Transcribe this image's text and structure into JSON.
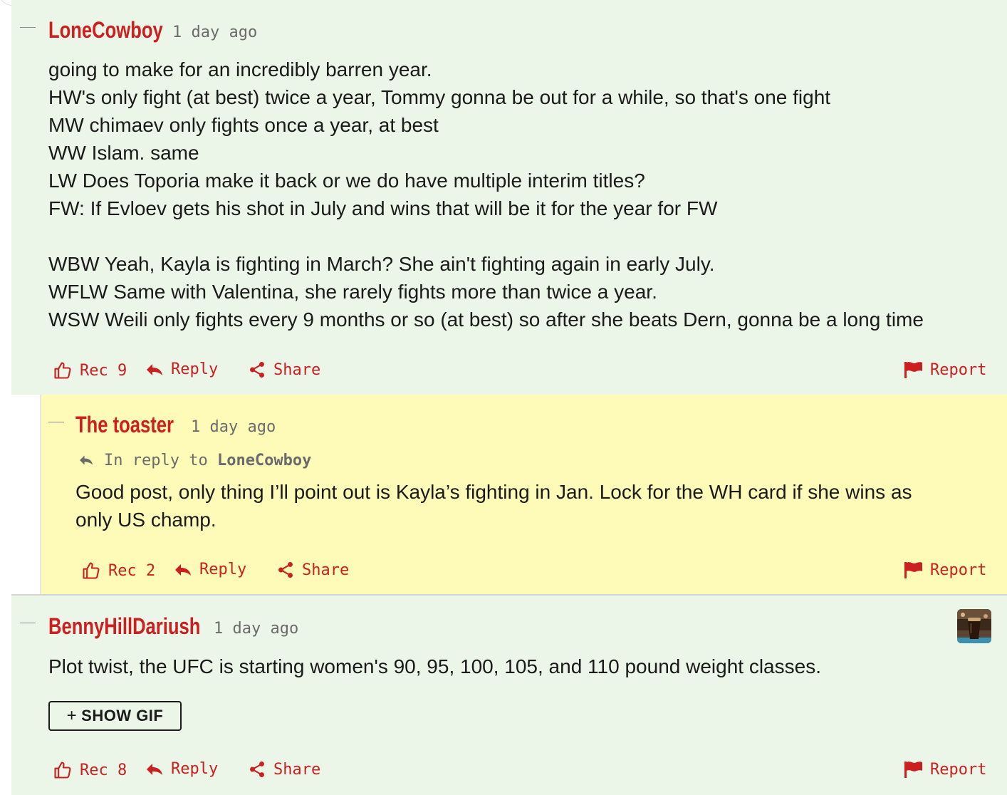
{
  "comments": [
    {
      "author": "LoneCowboy",
      "time": "1 day ago",
      "lines": [
        "going to make for an incredibly barren year.",
        "HW's only fight (at best) twice a year, Tommy gonna be out for a while, so that's one fight",
        "MW chimaev only fights once a year, at best",
        "WW Islam. same",
        "LW Does Toporia make it back or we do have multiple interim titles?",
        "FW: If Evloev gets his shot in July and wins that will be it for the year for FW",
        "",
        "WBW Yeah, Kayla is fighting in March? She ain't fighting again in early July.",
        "WFLW Same with Valentina, she rarely fights more than twice a year.",
        "WSW Weili only fights every 9 months or so (at best) so after she beats Dern, gonna be a long time"
      ],
      "rec": "Rec 9",
      "reply": "Reply",
      "share": "Share",
      "report": "Report"
    },
    {
      "author": "The toaster",
      "time": "1 day ago",
      "in_reply_prefix": "In reply to",
      "in_reply_name": "LoneCowboy",
      "lines": [
        "Good post, only thing I’ll point out is Kayla’s fighting in Jan. Lock for the WH card if she wins as",
        "only US champ."
      ],
      "rec": "Rec 2",
      "reply": "Reply",
      "share": "Share",
      "report": "Report"
    },
    {
      "author": "BennyHillDariush",
      "time": "1 day ago",
      "lines": [
        "Plot twist, the UFC is starting women's 90, 95, 100, 105, and 110 pound weight classes."
      ],
      "show_gif": "SHOW GIF",
      "rec": "Rec 8",
      "reply": "Reply",
      "share": "Share",
      "report": "Report"
    }
  ],
  "colors": {
    "accent": "#cc1f1f",
    "comment_bg": "#ecf6e8",
    "highlight_bg": "#fdfbb7",
    "text": "#1a1a1a",
    "muted": "#6b6b6b"
  },
  "icons": {
    "rec": "thumbs-up-icon",
    "reply": "reply-arrow-icon",
    "share": "share-icon",
    "report": "flag-icon",
    "show_gif": "plus-icon"
  }
}
